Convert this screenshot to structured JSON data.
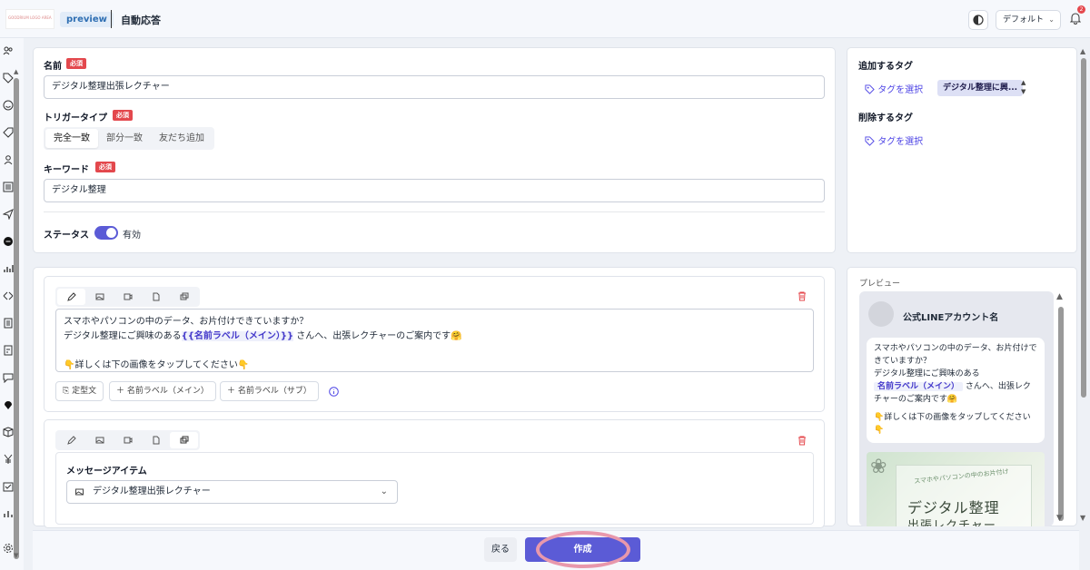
{
  "header": {
    "logo_text": "GOODRIUM LOGO AREA",
    "preview_badge": "preview",
    "page_title": "自動応答",
    "tenant_select": "デフォルト",
    "notification_count": "2"
  },
  "form": {
    "name_label": "名前",
    "required_badge": "必須",
    "name_value": "デジタル整理出張レクチャー",
    "trigger_label": "トリガータイプ",
    "trigger_options": [
      "完全一致",
      "部分一致",
      "友だち追加"
    ],
    "trigger_selected": "完全一致",
    "keyword_label": "キーワード",
    "keyword_value": "デジタル整理",
    "status_label": "ステータス",
    "status_value": "有効"
  },
  "tags": {
    "add_label": "追加するタグ",
    "add_select": "タグを選択",
    "add_chip": "デジタル整理に興...",
    "remove_label": "削除するタグ",
    "remove_select": "タグを選択"
  },
  "message1": {
    "line1": "スマホやパソコンの中のデータ、お片付けできていますか？",
    "line2_pre": "デジタル整理にご興味のある",
    "line2_var": "{{名前ラベル（メイン）}}",
    "line2_post": "さんへ、出張レクチャーのご案内です🤗",
    "line3": "👇詳しくは下の画像をタップしてください👇",
    "template_btn": "定型文",
    "name_main_btn": "名前ラベル（メイン）",
    "name_sub_btn": "名前ラベル（サブ）"
  },
  "message2": {
    "item_label": "メッセージアイテム",
    "item_select": "デジタル整理出張レクチャー"
  },
  "preview": {
    "title": "プレビュー",
    "account_name": "公式LINEアカウント名",
    "bubble_line1": "スマホやパソコンの中のデータ、お片付けできていますか？",
    "bubble_line2": "デジタル整理にご興味のある",
    "bubble_chip": "名前ラベル（メイン）",
    "bubble_line3": "さんへ、出張レク",
    "bubble_line4": "チャーのご案内です🤗",
    "bubble_line5": "👇詳しくは下の画像をタップしてください👇",
    "image_subtitle": "スマホやパソコンの中のお片付け",
    "image_title": "デジタル整理",
    "image_title2": "出張レクチャー"
  },
  "footer": {
    "back_label": "戻る",
    "create_label": "作成"
  },
  "colors": {
    "accent": "#5b5bd6",
    "required": "#e3484d",
    "highlight_ring": "#e898ac"
  }
}
